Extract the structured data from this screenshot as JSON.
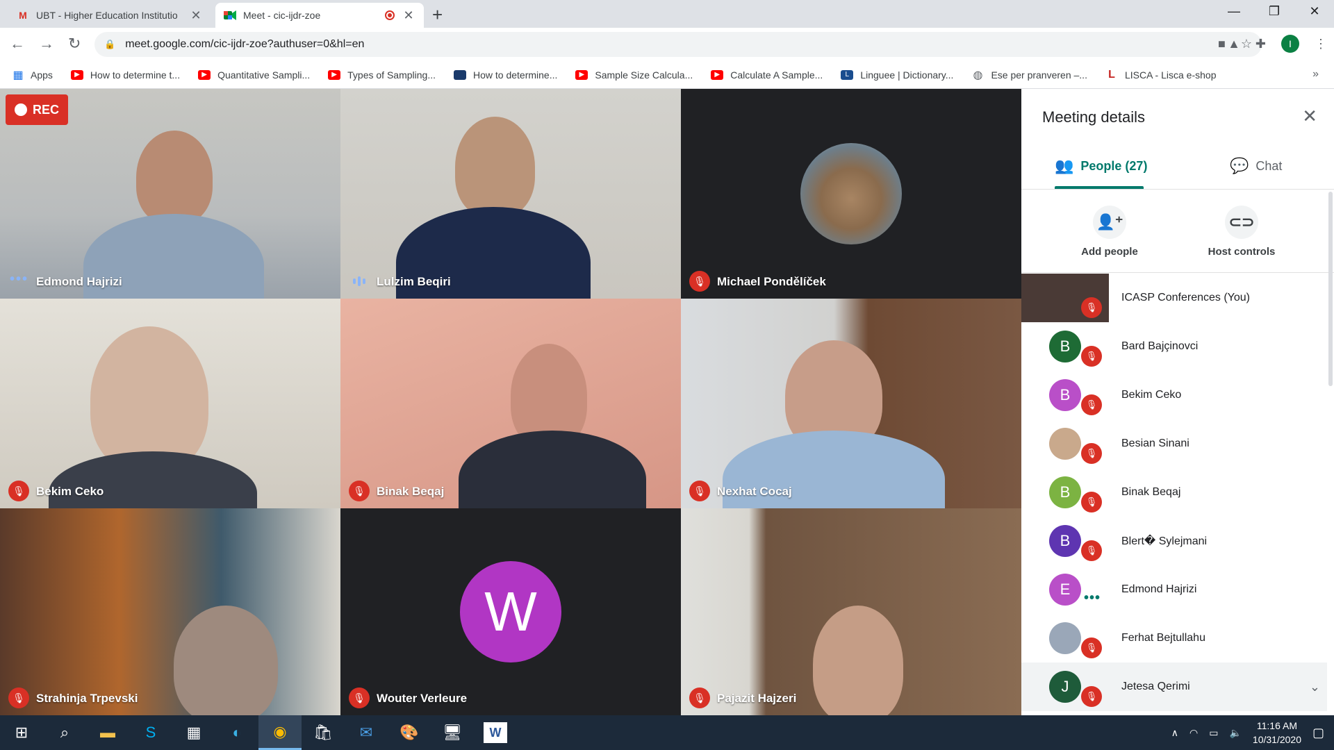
{
  "browser": {
    "tabs": [
      {
        "favicon": "M",
        "title": "UBT - Higher Education Institutio"
      },
      {
        "favicon": "meet",
        "title": "Meet - cic-ijdr-zoe"
      }
    ],
    "url": "meet.google.com/cic-ijdr-zoe?authuser=0&hl=en",
    "profile_initial": "I",
    "bookmarks": [
      {
        "icon": "apps-icon",
        "label": "Apps"
      },
      {
        "icon": "youtube-icon",
        "label": "How to determine t..."
      },
      {
        "icon": "youtube-icon",
        "label": "Quantitative Sampli..."
      },
      {
        "icon": "youtube-icon",
        "label": "Types of Sampling..."
      },
      {
        "icon": "doc-icon",
        "label": "How to determine..."
      },
      {
        "icon": "youtube-icon",
        "label": "Sample Size Calcula..."
      },
      {
        "icon": "youtube-icon",
        "label": "Calculate A Sample..."
      },
      {
        "icon": "linguee-icon",
        "label": "Linguee | Dictionary..."
      },
      {
        "icon": "globe-icon",
        "label": "Ese per pranveren –..."
      },
      {
        "icon": "lisca-icon",
        "label": "LISCA - Lisca e-shop"
      }
    ]
  },
  "meeting": {
    "rec_label": "REC",
    "tiles": [
      {
        "name": "Edmond Hajrizi",
        "status": "dots"
      },
      {
        "name": "Lulzim Beqiri",
        "status": "speaking"
      },
      {
        "name": "Michael Pondělíček",
        "status": "muted"
      },
      {
        "name": "Bekim Ceko",
        "status": "muted"
      },
      {
        "name": "Binak Beqaj",
        "status": "muted"
      },
      {
        "name": "Nexhat Cocaj",
        "status": "muted"
      },
      {
        "name": "Strahinja Trpevski",
        "status": "muted"
      },
      {
        "name": "Wouter Verleure",
        "status": "muted",
        "initial": "W"
      },
      {
        "name": "Pajazit Hajzeri",
        "status": "muted"
      }
    ]
  },
  "panel": {
    "title": "Meeting details",
    "tab_people": "People (27)",
    "tab_chat": "Chat",
    "add_people": "Add people",
    "host_controls": "Host controls",
    "participants": [
      {
        "name": "ICASP Conferences (You)",
        "initial": "",
        "color": "#4a3a36",
        "status": "muted"
      },
      {
        "name": "Bard Bajçinovci",
        "initial": "B",
        "color": "#1e6b35",
        "status": "muted"
      },
      {
        "name": "Bekim Ceko",
        "initial": "B",
        "color": "#b94fc8",
        "status": "muted"
      },
      {
        "name": "Besian Sinani",
        "initial": "",
        "color": "#c9a98c",
        "status": "muted"
      },
      {
        "name": "Binak Beqaj",
        "initial": "B",
        "color": "#7cb342",
        "status": "muted"
      },
      {
        "name": "Blert� Sylejmani",
        "initial": "B",
        "color": "#5e35b1",
        "status": "muted"
      },
      {
        "name": "Edmond Hajrizi",
        "initial": "E",
        "color": "#b94fc8",
        "status": "dots"
      },
      {
        "name": "Ferhat Bejtullahu",
        "initial": "",
        "color": "#9aa7b8",
        "status": "muted"
      },
      {
        "name": "Jetesa Qerimi",
        "initial": "J",
        "color": "#1e5b3a",
        "status": "muted"
      }
    ]
  },
  "taskbar": {
    "time": "11:16 AM",
    "date": "10/31/2020"
  }
}
